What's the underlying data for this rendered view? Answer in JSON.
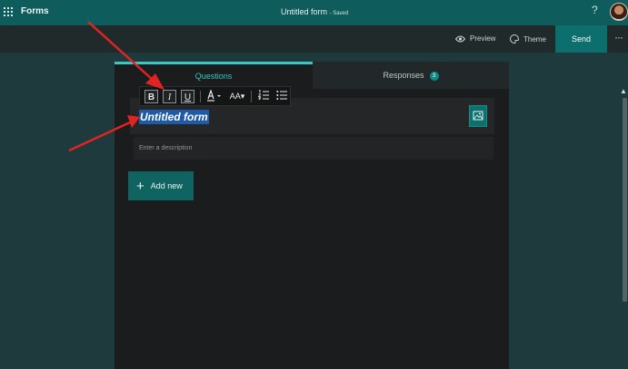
{
  "app": {
    "name": "Forms"
  },
  "document": {
    "title": "Untitled form",
    "status": "- Saved"
  },
  "header": {
    "help": "?"
  },
  "commandbar": {
    "preview_label": "Preview",
    "theme_label": "Theme",
    "send_label": "Send",
    "more": "···"
  },
  "tabs": [
    {
      "label": "Questions",
      "active": true
    },
    {
      "label": "Responses",
      "badge": "3"
    }
  ],
  "format_toolbar": {
    "bold": "B",
    "italic": "I",
    "underline": "U",
    "font_size": "AA",
    "icons": [
      "bold-icon",
      "italic-icon",
      "underline-icon",
      "font-color-icon",
      "font-size-icon",
      "numbered-list-icon",
      "bullet-list-icon"
    ]
  },
  "form": {
    "title": "Untitled form",
    "description_placeholder": "Enter a description",
    "add_new_label": "Add new"
  },
  "colors": {
    "header": "#0f5c5c",
    "accent": "#3cc7c1",
    "send_button": "#0d6e6e",
    "annotation_arrow": "#e02424"
  }
}
